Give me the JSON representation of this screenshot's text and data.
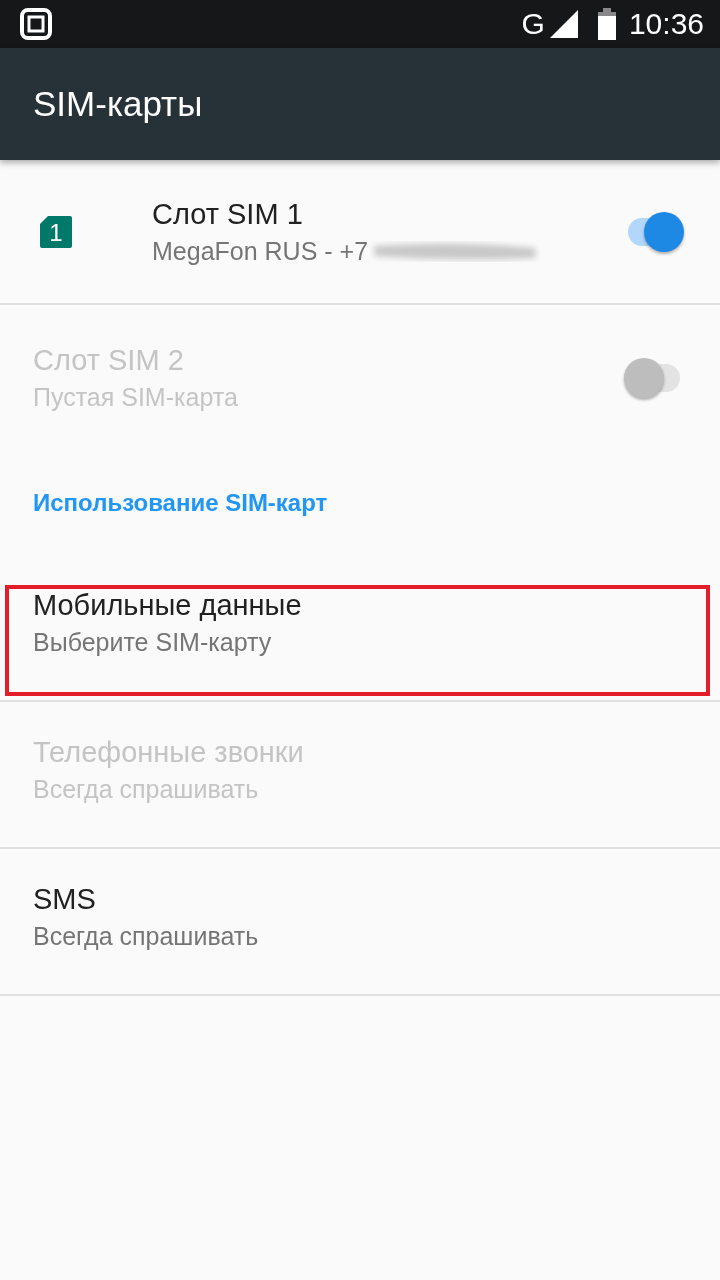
{
  "status_bar": {
    "network_type": "G",
    "time": "10:36"
  },
  "app_bar": {
    "title": "SIM-карты"
  },
  "items": [
    {
      "kind": "sim",
      "icon_label": "1",
      "title": "Слот SIM 1",
      "summary": "MegaFon RUS - +7",
      "redacted": true,
      "on": true,
      "disabled": false
    },
    {
      "kind": "sim",
      "title": "Слот SIM 2",
      "summary": "Пустая SIM-карта",
      "redacted": false,
      "on": false,
      "disabled": true
    },
    {
      "kind": "category",
      "title": "Использование SIM-карт"
    },
    {
      "kind": "pref",
      "title": "Мобильные данные",
      "summary": "Выберите SIM-карту",
      "disabled": false,
      "highlighted": true
    },
    {
      "kind": "pref",
      "title": "Телефонные звонки",
      "summary": "Всегда спрашивать",
      "disabled": true,
      "highlighted": false
    },
    {
      "kind": "pref",
      "title": "SMS",
      "summary": "Всегда спрашивать",
      "disabled": false,
      "highlighted": false
    }
  ]
}
